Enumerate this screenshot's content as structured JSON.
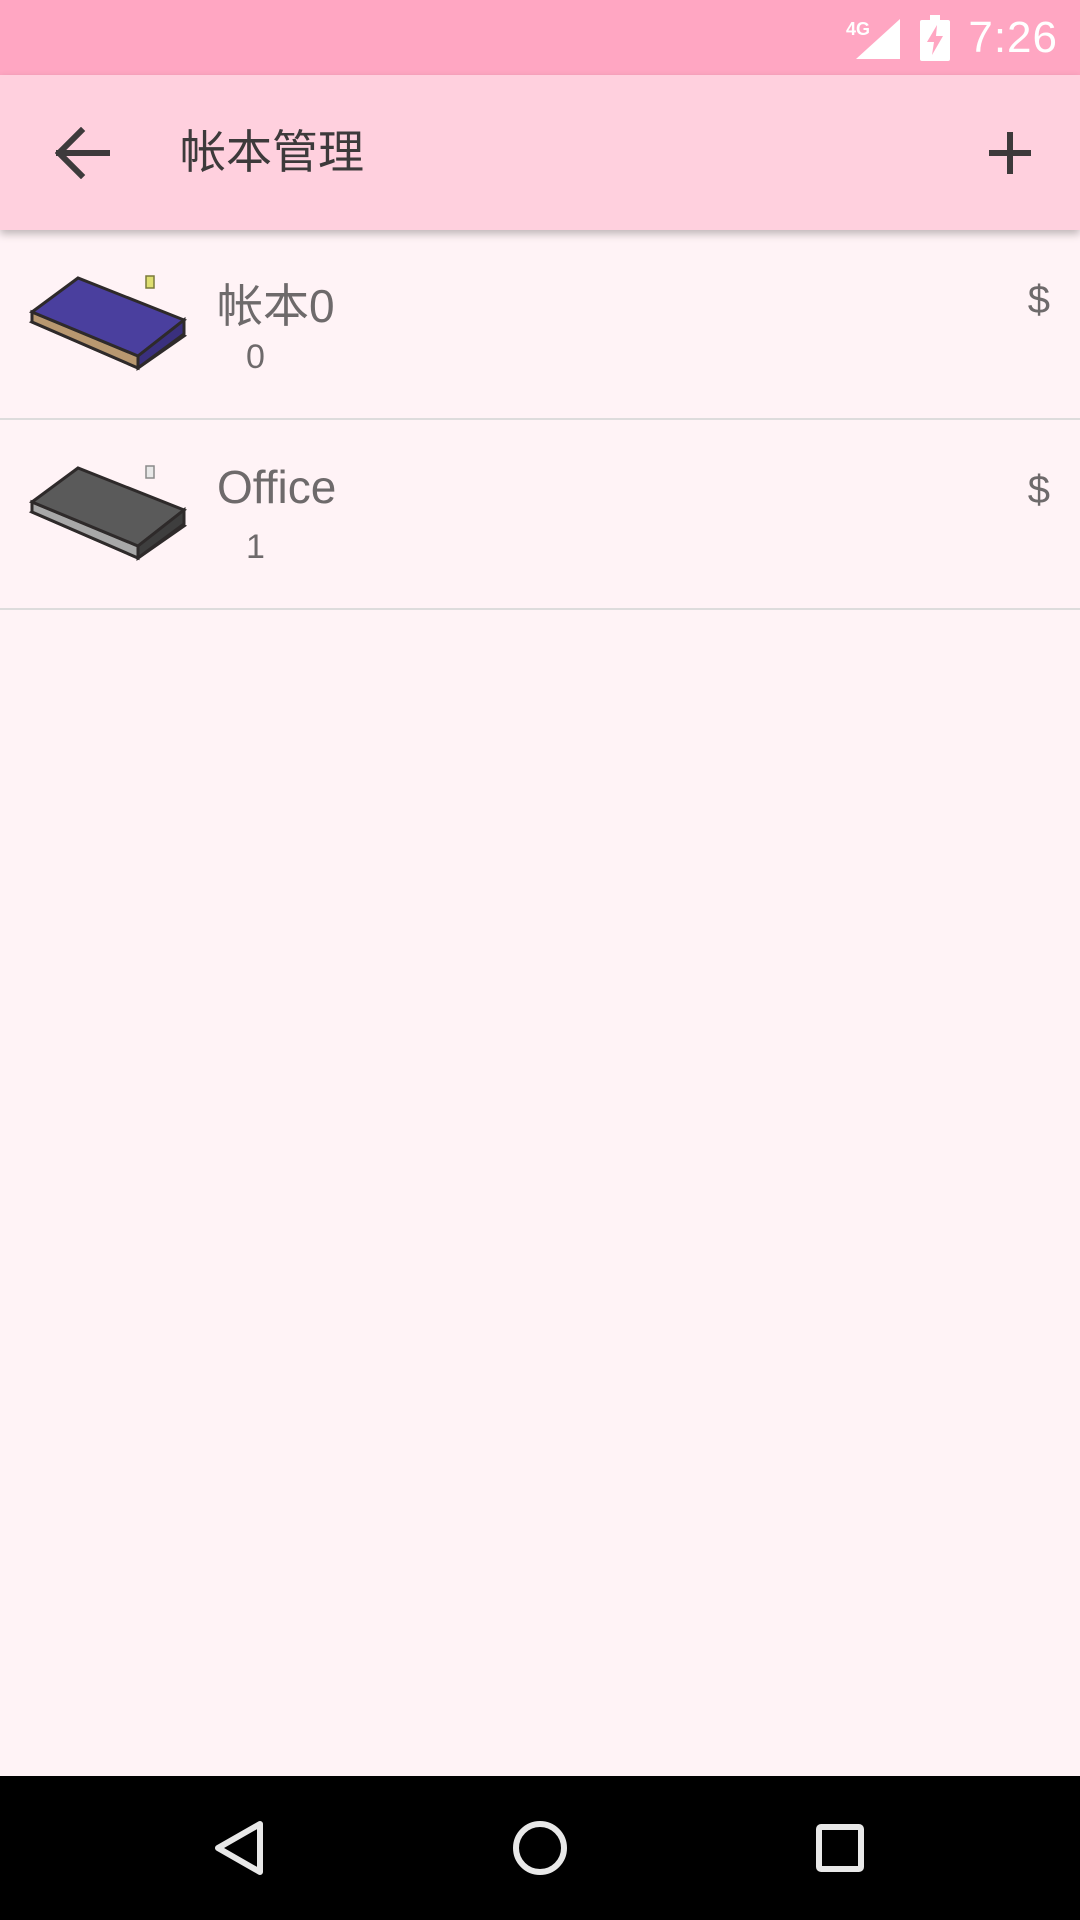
{
  "status_bar": {
    "network": "4G",
    "time": "7:26"
  },
  "app_bar": {
    "title": "帐本管理",
    "back_icon": "arrow-back-icon",
    "add_icon": "plus-icon"
  },
  "books": [
    {
      "name": "帐本0",
      "count": "0",
      "currency": "$",
      "icon": "blue-book-icon"
    },
    {
      "name": "Office",
      "count": "1",
      "currency": "$",
      "icon": "gray-book-icon"
    }
  ],
  "nav_bar": {
    "back": "back-triangle-icon",
    "home": "home-circle-icon",
    "recents": "recents-square-icon"
  },
  "colors": {
    "status_bar": "#ffa6c2",
    "app_bar": "#ffd0de",
    "background": "#fff3f6"
  }
}
